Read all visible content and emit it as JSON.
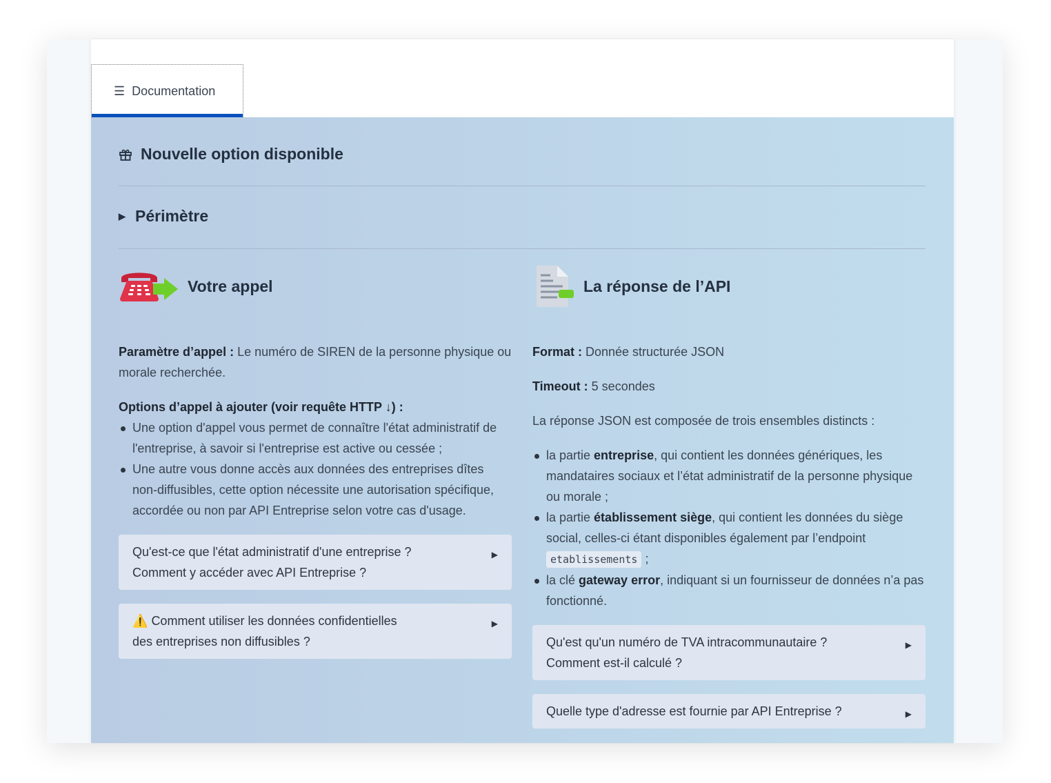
{
  "tab": {
    "label": "Documentation",
    "icon": "list-icon"
  },
  "banner": {
    "title": "Nouvelle option disponible",
    "icon": "gift-icon"
  },
  "perimetre": {
    "label": "Périmètre"
  },
  "left": {
    "title": "Votre appel",
    "param_label": "Paramètre d’appel :",
    "param_text": " Le numéro de SIREN de la personne physique ou morale recherchée.",
    "options_label": "Options d’appel à ajouter (voir requête HTTP ↓) :",
    "bullets": [
      "Une option d'appel vous permet de connaître l'état administratif de l'entreprise, à savoir si l'entreprise est active ou cessée ;",
      "Une autre vous donne accès aux données des entreprises dîtes non-diffusibles, cette option nécessite une autorisation spécifique, accordée ou non par API Entreprise selon votre cas d'usage."
    ],
    "faq": [
      {
        "line1": "Qu'est-ce que l'état administratif d'une entreprise ?",
        "line2": "Comment y accéder avec API Entreprise ?"
      },
      {
        "warning": "⚠️",
        "line1": "Comment utiliser les données confidentielles",
        "line2": "des entreprises non diffusibles ?"
      }
    ]
  },
  "right": {
    "title": "La réponse de l’API",
    "format_label": "Format :",
    "format_value": " Donnée structurée JSON",
    "timeout_label": "Timeout :",
    "timeout_value": " 5 secondes",
    "intro": "La réponse JSON est composée de trois ensembles distincts :",
    "b1": {
      "pre": "la partie ",
      "bold": "entreprise",
      "post": ", qui contient les données génériques, les mandataires sociaux et l’état administratif de la personne physique ou morale ;"
    },
    "b2": {
      "pre": "la partie ",
      "bold": "établissement siège",
      "post": ", qui contient les données du siège social, celles-ci étant disponibles également par l’endpoint ",
      "code": "etablissements",
      "end": " ;"
    },
    "b3": {
      "pre": "la clé ",
      "bold": "gateway error",
      "post": ", indiquant si un fournisseur de données n’a pas fonctionné."
    },
    "faq": [
      {
        "line1": "Qu'est qu'un numéro de TVA intracommunautaire ?",
        "line2": "Comment est-il calculé ?"
      },
      {
        "line1": "Quelle type d'adresse est fournie par API Entreprise ?"
      }
    ]
  },
  "colors": {
    "accent": "#0a4fbd",
    "panel_left": "#b9cce3",
    "panel_right": "#c1dded"
  }
}
